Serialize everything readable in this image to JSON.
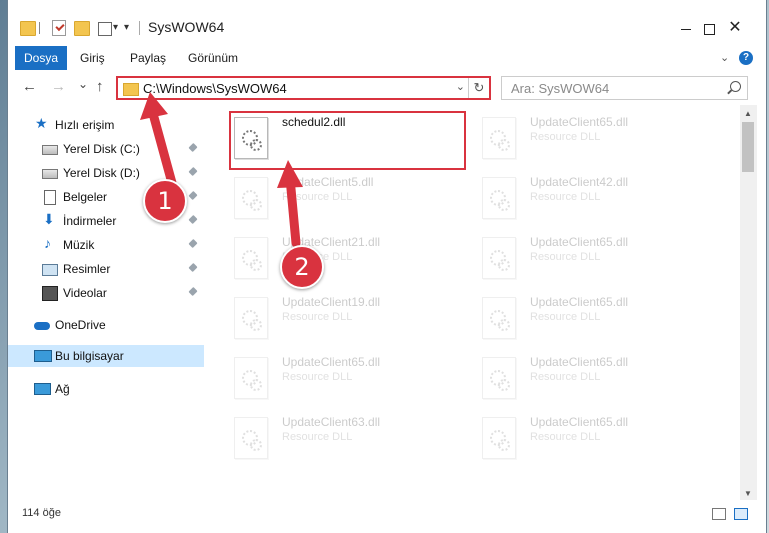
{
  "window": {
    "title": "SysWOW64"
  },
  "ribbon": {
    "tabs": [
      "Dosya",
      "Giriş",
      "Paylaş",
      "Görünüm"
    ],
    "help_label": "?"
  },
  "navbar": {
    "back_glyph": "←",
    "forward_glyph": "→",
    "recent_glyph": "⌄",
    "up_glyph": "↑",
    "address": "C:\\Windows\\SysWOW64",
    "refresh_glyph": "↻",
    "search_placeholder": "Ara: SysWOW64"
  },
  "sidebar": {
    "items": [
      {
        "label": "Hızlı erişim",
        "icon": "star-icon",
        "pinned": false
      },
      {
        "label": "Yerel Disk (C:)",
        "icon": "disk-icon",
        "pinned": true
      },
      {
        "label": "Yerel Disk (D:)",
        "icon": "disk-icon",
        "pinned": true
      },
      {
        "label": "Belgeler",
        "icon": "document-icon",
        "pinned": true
      },
      {
        "label": "İndirmeler",
        "icon": "download-icon",
        "pinned": true
      },
      {
        "label": "Müzik",
        "icon": "music-icon",
        "pinned": true
      },
      {
        "label": "Resimler",
        "icon": "pictures-icon",
        "pinned": true
      },
      {
        "label": "Videolar",
        "icon": "video-icon",
        "pinned": true
      },
      {
        "label": "OneDrive",
        "icon": "cloud-icon",
        "pinned": false
      },
      {
        "label": "Bu bilgisayar",
        "icon": "pc-icon",
        "pinned": false,
        "selected": true
      },
      {
        "label": "Ağ",
        "icon": "network-icon",
        "pinned": false
      }
    ]
  },
  "files": {
    "left": [
      {
        "name": "schedul2.dll",
        "type": ""
      },
      {
        "name": "UpdateClient5.dll",
        "type": "Resource DLL"
      },
      {
        "name": "UpdateClient21.dll",
        "type": "Resource DLL"
      },
      {
        "name": "UpdateClient19.dll",
        "type": "Resource DLL"
      },
      {
        "name": "UpdateClient65.dll",
        "type": "Resource DLL"
      },
      {
        "name": "UpdateClient63.dll",
        "type": "Resource DLL"
      }
    ],
    "right": [
      {
        "name": "UpdateClient65.dll",
        "type": "Resource DLL"
      },
      {
        "name": "UpdateClient42.dll",
        "type": "Resource DLL"
      },
      {
        "name": "UpdateClient65.dll",
        "type": "Resource DLL"
      },
      {
        "name": "UpdateClient65.dll",
        "type": "Resource DLL"
      },
      {
        "name": "UpdateClient65.dll",
        "type": "Resource DLL"
      },
      {
        "name": "UpdateClient65.dll",
        "type": "Resource DLL"
      }
    ]
  },
  "status": {
    "item_count": "114 öğe"
  },
  "annotations": {
    "step1": "1",
    "step2": "2",
    "color": "#d9333f"
  }
}
